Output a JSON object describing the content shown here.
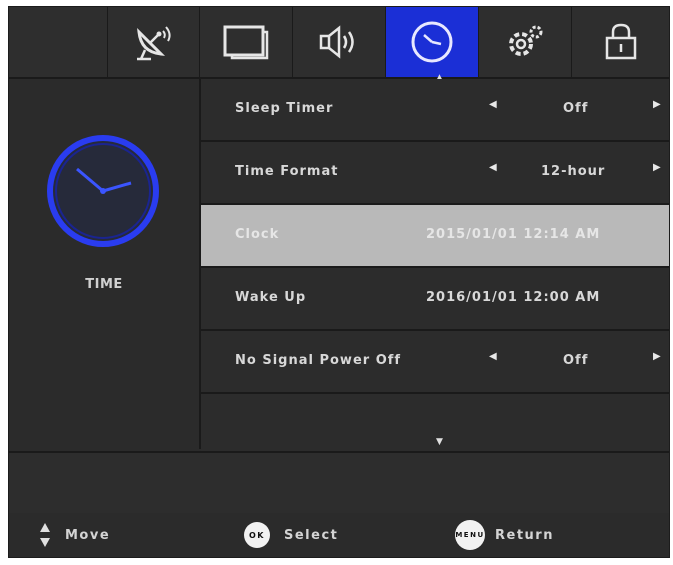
{
  "tabs": [
    {
      "name": "satellite-dish-icon",
      "active": false
    },
    {
      "name": "screen-icon",
      "active": false
    },
    {
      "name": "speaker-icon",
      "active": false
    },
    {
      "name": "clock-icon",
      "active": true
    },
    {
      "name": "gear-icon",
      "active": false
    },
    {
      "name": "lock-icon",
      "active": false
    }
  ],
  "colors": {
    "active_tab": "#1b2fd6",
    "clock_ring": "#2a3cf0",
    "selected_row": "#b9b9b9"
  },
  "left_pane": {
    "title": "TIME",
    "icon": "clock-icon"
  },
  "menu": {
    "items": [
      {
        "label": "Sleep Timer",
        "value": "Off",
        "has_arrows": true
      },
      {
        "label": "Time Format",
        "value": "12-hour",
        "has_arrows": true
      },
      {
        "label": "Clock",
        "value": "2015/01/01 12:14 AM",
        "has_arrows": false,
        "selected": true
      },
      {
        "label": "Wake Up",
        "value": "2016/01/01 12:00 AM",
        "has_arrows": false
      },
      {
        "label": "No Signal Power Off",
        "value": "Off",
        "has_arrows": true
      }
    ]
  },
  "help": {
    "move_label": "Move",
    "ok_glyph": "OK",
    "select_label": "Select",
    "menu_glyph": "MENU",
    "return_label": "Return"
  }
}
